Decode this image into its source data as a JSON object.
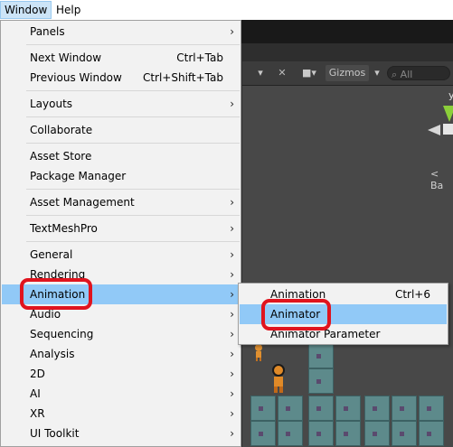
{
  "menubar": {
    "items": [
      {
        "label": "Window"
      },
      {
        "label": "Help"
      }
    ]
  },
  "scene_toolbar": {
    "gizmos_label": "Gizmos",
    "search_placeholder": "All"
  },
  "scene": {
    "gizmo_axis_label": "y",
    "gizmo_persp_label": "< Ba"
  },
  "window_menu": {
    "items": [
      {
        "label": "Panels",
        "submenu": true
      },
      {
        "label": "Next Window",
        "shortcut": "Ctrl+Tab"
      },
      {
        "label": "Previous Window",
        "shortcut": "Ctrl+Shift+Tab"
      },
      {
        "label": "Layouts",
        "submenu": true
      },
      {
        "label": "Collaborate"
      },
      {
        "label": "Asset Store"
      },
      {
        "label": "Package Manager"
      },
      {
        "label": "Asset Management",
        "submenu": true
      },
      {
        "label": "TextMeshPro",
        "submenu": true
      },
      {
        "label": "General",
        "submenu": true
      },
      {
        "label": "Rendering",
        "submenu": true
      },
      {
        "label": "Animation",
        "submenu": true,
        "highlighted": true
      },
      {
        "label": "Audio",
        "submenu": true
      },
      {
        "label": "Sequencing",
        "submenu": true
      },
      {
        "label": "Analysis",
        "submenu": true
      },
      {
        "label": "2D",
        "submenu": true
      },
      {
        "label": "AI",
        "submenu": true
      },
      {
        "label": "XR",
        "submenu": true
      },
      {
        "label": "UI Toolkit",
        "submenu": true
      }
    ]
  },
  "animation_submenu": {
    "items": [
      {
        "label": "Animation",
        "shortcut": "Ctrl+6"
      },
      {
        "label": "Animator",
        "highlighted": true
      },
      {
        "label": "Animator Parameter"
      }
    ]
  },
  "colors": {
    "highlight": "#91c9f7",
    "annotation_red": "#e0141e",
    "menu_bg": "#f2f2f2"
  }
}
